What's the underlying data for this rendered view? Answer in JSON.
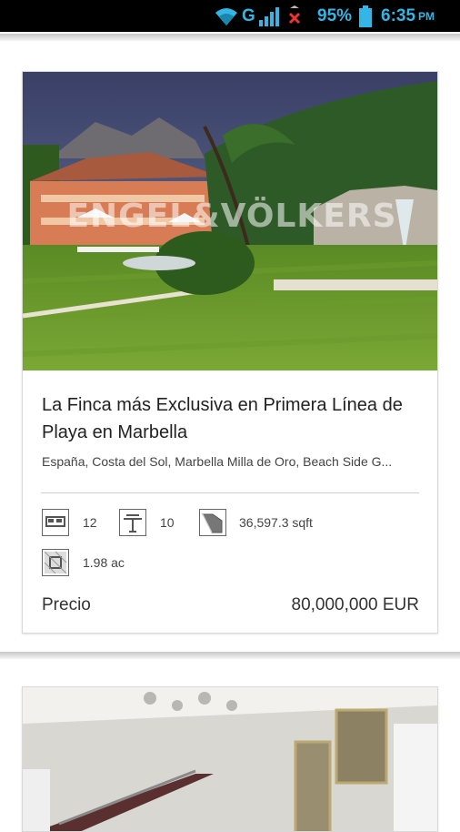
{
  "status_bar": {
    "network": "G",
    "battery_percent": "95%",
    "time": "6:35",
    "time_suffix": "PM"
  },
  "listings": [
    {
      "image_watermark": "ENGEL&VÖLKERS",
      "title": "La Finca más Exclusiva en Primera Línea de Playa en Marbella",
      "location": "España, Costa del Sol, Marbella Milla de Oro, Beach Side G...",
      "bedrooms": "12",
      "bathrooms": "10",
      "living_area": "36,597.3 sqft",
      "land_area": "1.98 ac",
      "price_label": "Precio",
      "price_value": "80,000,000 EUR"
    }
  ],
  "colors": {
    "status_accent": "#33b5e5",
    "text_primary": "#222222",
    "text_secondary": "#444444",
    "card_border": "#d9d9d9"
  }
}
